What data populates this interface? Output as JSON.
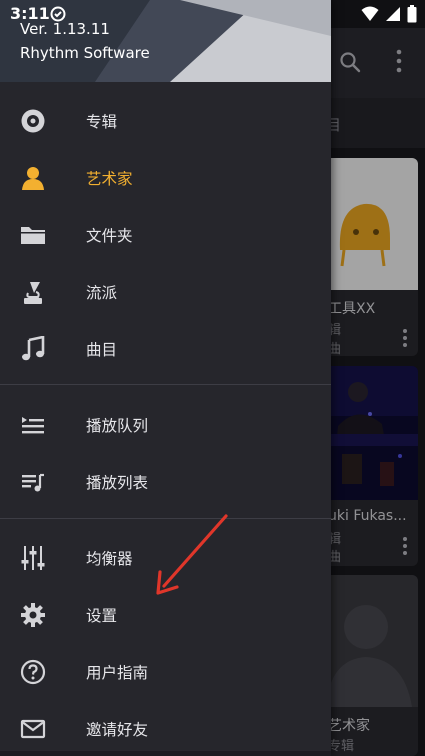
{
  "status_bar": {
    "time": "3:11"
  },
  "drawer": {
    "version": "Ver. 1.13.11",
    "company": "Rhythm Software",
    "accent_color": "#f3b030",
    "items": [
      {
        "label": "专辑",
        "icon": "album-icon"
      },
      {
        "label": "艺术家",
        "icon": "artist-icon",
        "active": true
      },
      {
        "label": "文件夹",
        "icon": "folder-icon"
      },
      {
        "label": "流派",
        "icon": "gramophone-icon"
      },
      {
        "label": "曲目",
        "icon": "music-note-icon"
      },
      {
        "label": "播放队列",
        "icon": "queue-icon"
      },
      {
        "label": "播放列表",
        "icon": "playlist-icon"
      },
      {
        "label": "均衡器",
        "icon": "equalizer-icon"
      },
      {
        "label": "设置",
        "icon": "gear-icon"
      },
      {
        "label": "用户指南",
        "icon": "help-icon"
      },
      {
        "label": "邀请好友",
        "icon": "mail-icon"
      }
    ]
  },
  "background": {
    "tab_label": "目",
    "cards": [
      {
        "title": "工具XX",
        "line2": "辑",
        "line3": "曲"
      },
      {
        "title": "uki Fukas...",
        "line2": "辑",
        "line3": "曲"
      },
      {
        "title": "艺术家",
        "line2": "专辑",
        "line3": ""
      }
    ]
  }
}
